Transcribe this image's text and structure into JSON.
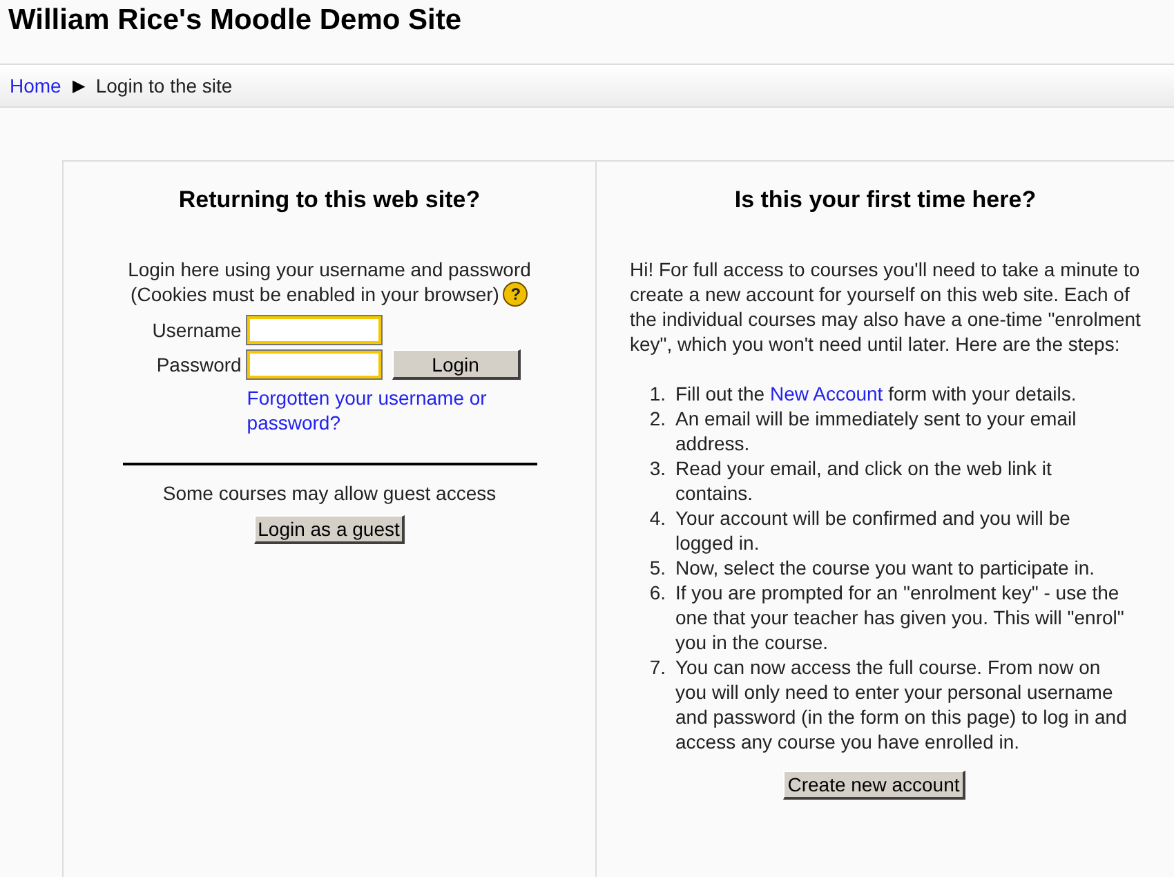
{
  "site_title": "William Rice's Moodle Demo Site",
  "breadcrumb": {
    "home": "Home",
    "separator": "▶",
    "current": "Login to the site"
  },
  "login": {
    "heading": "Returning to this web site?",
    "intro_1": "Login here using your username and password",
    "intro_2": "(Cookies must be enabled in your browser)",
    "help_icon": "?",
    "username_label": "Username",
    "password_label": "Password",
    "login_button": "Login",
    "forgot_link": "Forgotten your username or password?",
    "guest_text": "Some courses may allow guest access",
    "guest_button": "Login as a guest"
  },
  "signup": {
    "heading": "Is this your first time here?",
    "intro": "Hi! For full access to courses you'll need to take a minute to create a new account for yourself on this web site. Each of the individual courses may also have a one-time \"enrolment key\", which you won't need until later. Here are the steps:",
    "steps": [
      {
        "number": "1.",
        "before": "Fill out the ",
        "link": "New Account",
        "after": " form with your details."
      },
      {
        "number": "2.",
        "before": "An email will be immediately sent to your email address."
      },
      {
        "number": "3.",
        "before": "Read your email, and click on the web link it contains."
      },
      {
        "number": "4.",
        "before": "Your account will be confirmed and you will be logged in."
      },
      {
        "number": "5.",
        "before": "Now, select the course you want to participate in."
      },
      {
        "number": "6.",
        "before": "If you are prompted for an \"enrolment key\" - use the one that your teacher has given you. This will \"enrol\" you in the course."
      },
      {
        "number": "7.",
        "before": "You can now access the full course. From now on you will only need to enter your personal username and password (in the form on this page) to log in and access any course you have enrolled in."
      }
    ],
    "create_button": "Create new account"
  }
}
